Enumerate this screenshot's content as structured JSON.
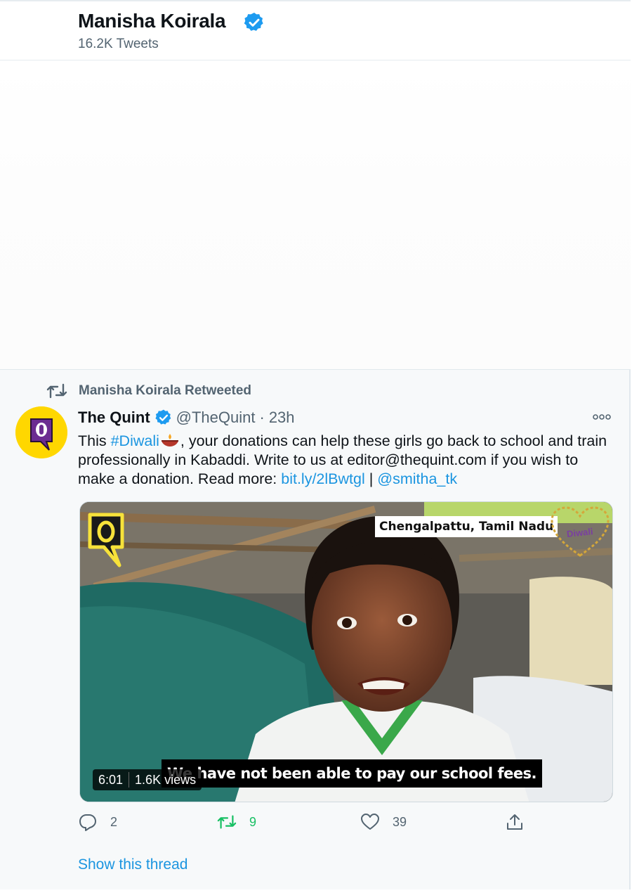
{
  "profile_header": {
    "name": "Manisha Koirala",
    "tweet_count": "16.2K Tweets"
  },
  "tweet": {
    "retweet_label": "Manisha Koirala Retweeted",
    "author_name": "The Quint",
    "author_handle": "@TheQuint",
    "separator": "·",
    "time": "23h",
    "text_pre": "This ",
    "hashtag": "#Diwali",
    "text_mid": ", your donations can help these girls go back to school and train professionally in Kabaddi. Write to us at editor@thequint.com if you wish to make a donation. Read more: ",
    "link": "bit.ly/2lBwtgl",
    "pipe": " | ",
    "mention": "@smitha_tk",
    "video": {
      "location": "Chengalpattu, Tamil Nadu",
      "caption": "We have not been able to pay our school fees.",
      "duration": "6:01",
      "views": "1.6K views",
      "badge_text": "Diwali"
    },
    "actions": {
      "replies": "2",
      "retweets": "9",
      "likes": "39"
    },
    "show_thread": "Show this thread"
  },
  "colors": {
    "link_blue": "#1b95e0",
    "retweet_green": "#17bf63",
    "muted_gray": "#536471",
    "brand_yellow": "#ffd700",
    "brand_purple": "#6b2c91"
  },
  "icons": [
    "verified-icon",
    "retweet-icon",
    "more-icon",
    "reply-icon",
    "like-icon",
    "share-icon"
  ]
}
